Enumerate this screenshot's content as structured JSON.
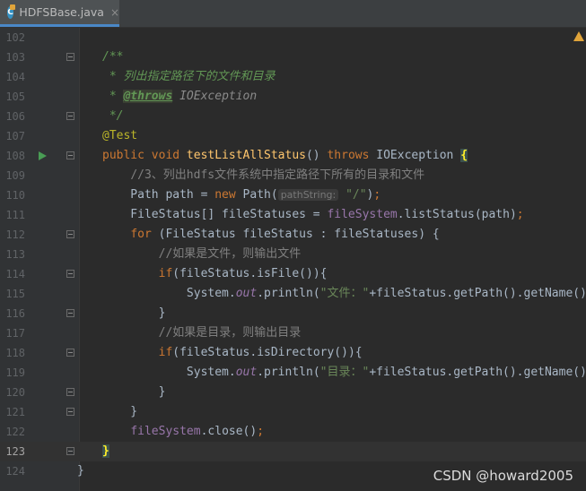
{
  "tab": {
    "icon_letter": "C",
    "file_name": "HDFSBase.java",
    "close_glyph": "×"
  },
  "watermark": "CSDN @howard2005",
  "colors": {
    "background": "#2b2b2b",
    "gutter": "#313335",
    "keyword": "#cc7832",
    "method": "#ffc66d",
    "comment": "#629755",
    "line_comment": "#808080",
    "string": "#6a8759",
    "field": "#9876aa",
    "annotation": "#bbb529"
  },
  "lines": [
    {
      "num": "102",
      "parts": []
    },
    {
      "num": "103",
      "fold": true,
      "parts": [
        {
          "t": "/**",
          "c": "cm"
        }
      ]
    },
    {
      "num": "104",
      "parts": [
        {
          "t": " * 列出指定路径下的文件和目录",
          "c": "cm"
        }
      ]
    },
    {
      "num": "105",
      "parts": [
        {
          "t": " * ",
          "c": "cm"
        },
        {
          "t": "@throws",
          "c": "cmtag"
        },
        {
          "t": " IOException",
          "c": "cmtext"
        }
      ]
    },
    {
      "num": "106",
      "fold": true,
      "parts": [
        {
          "t": " */",
          "c": "cm"
        }
      ]
    },
    {
      "num": "107",
      "parts": [
        {
          "t": "@Test",
          "c": "ann"
        }
      ]
    },
    {
      "num": "108",
      "run": true,
      "fold": true,
      "parts": [
        {
          "t": "public void ",
          "c": "kw"
        },
        {
          "t": "testListAllStatus",
          "c": "method"
        },
        {
          "t": "() ",
          "c": "plain"
        },
        {
          "t": "throws ",
          "c": "kw"
        },
        {
          "t": "IOException ",
          "c": "plain"
        },
        {
          "t": "{",
          "c": "bracematch"
        }
      ]
    },
    {
      "num": "109",
      "parts": [
        {
          "t": "    ",
          "c": "plain"
        },
        {
          "t": "//3、列出hdfs文件系统中指定路径下所有的目录和文件",
          "c": "lc"
        }
      ]
    },
    {
      "num": "110",
      "parts": [
        {
          "t": "    Path path = ",
          "c": "plain"
        },
        {
          "t": "new ",
          "c": "kw"
        },
        {
          "t": "Path(",
          "c": "plain"
        },
        {
          "t": "pathString:",
          "c": "hint"
        },
        {
          "t": " ",
          "c": "plain"
        },
        {
          "t": "\"/\"",
          "c": "str"
        },
        {
          "t": ")",
          "c": "plain"
        },
        {
          "t": ";",
          "c": "kw"
        }
      ]
    },
    {
      "num": "111",
      "parts": [
        {
          "t": "    FileStatus[] fileStatuses = ",
          "c": "plain"
        },
        {
          "t": "fileSystem",
          "c": "field"
        },
        {
          "t": ".listStatus(path)",
          "c": "plain"
        },
        {
          "t": ";",
          "c": "kw"
        }
      ]
    },
    {
      "num": "112",
      "fold": true,
      "parts": [
        {
          "t": "    ",
          "c": "plain"
        },
        {
          "t": "for ",
          "c": "kw"
        },
        {
          "t": "(FileStatus fileStatus : fileStatuses) {",
          "c": "plain"
        }
      ]
    },
    {
      "num": "113",
      "parts": [
        {
          "t": "        ",
          "c": "plain"
        },
        {
          "t": "//如果是文件，则输出文件",
          "c": "lc"
        }
      ]
    },
    {
      "num": "114",
      "fold": true,
      "parts": [
        {
          "t": "        ",
          "c": "plain"
        },
        {
          "t": "if",
          "c": "kw"
        },
        {
          "t": "(fileStatus.isFile()){",
          "c": "plain"
        }
      ]
    },
    {
      "num": "115",
      "parts": [
        {
          "t": "            System.",
          "c": "plain"
        },
        {
          "t": "out",
          "c": "static"
        },
        {
          "t": ".println(",
          "c": "plain"
        },
        {
          "t": "\"文件：\"",
          "c": "str"
        },
        {
          "t": "+fileStatus.getPath().getName())",
          "c": "plain"
        },
        {
          "t": ";",
          "c": "kw"
        }
      ]
    },
    {
      "num": "116",
      "fold": true,
      "parts": [
        {
          "t": "        }",
          "c": "plain"
        }
      ]
    },
    {
      "num": "117",
      "parts": [
        {
          "t": "        ",
          "c": "plain"
        },
        {
          "t": "//如果是目录，则输出目录",
          "c": "lc"
        }
      ]
    },
    {
      "num": "118",
      "fold": true,
      "parts": [
        {
          "t": "        ",
          "c": "plain"
        },
        {
          "t": "if",
          "c": "kw"
        },
        {
          "t": "(fileStatus.isDirectory()){",
          "c": "plain"
        }
      ]
    },
    {
      "num": "119",
      "parts": [
        {
          "t": "            System.",
          "c": "plain"
        },
        {
          "t": "out",
          "c": "static"
        },
        {
          "t": ".println(",
          "c": "plain"
        },
        {
          "t": "\"目录：\"",
          "c": "str"
        },
        {
          "t": "+fileStatus.getPath().getName())",
          "c": "plain"
        },
        {
          "t": ";",
          "c": "kw"
        }
      ]
    },
    {
      "num": "120",
      "fold": true,
      "parts": [
        {
          "t": "        }",
          "c": "plain"
        }
      ]
    },
    {
      "num": "121",
      "fold": true,
      "parts": [
        {
          "t": "    }",
          "c": "plain"
        }
      ]
    },
    {
      "num": "122",
      "parts": [
        {
          "t": "    ",
          "c": "plain"
        },
        {
          "t": "fileSystem",
          "c": "field"
        },
        {
          "t": ".close()",
          "c": "plain"
        },
        {
          "t": ";",
          "c": "kw"
        }
      ]
    },
    {
      "num": "123",
      "current": true,
      "fold": true,
      "parts": [
        {
          "t": "}",
          "c": "bracematch"
        }
      ]
    },
    {
      "num": "124",
      "outer": true,
      "parts": [
        {
          "t": "}",
          "c": "plain"
        }
      ]
    }
  ]
}
